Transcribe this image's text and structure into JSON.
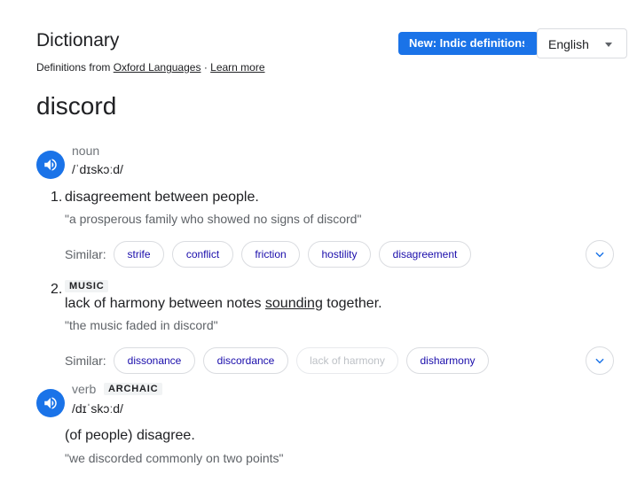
{
  "header": {
    "title": "Dictionary",
    "source_prefix": "Definitions from",
    "source_name": "Oxford Languages",
    "separator": "·",
    "learn_more": "Learn more",
    "promo": "New: Indic definitions",
    "language": "English"
  },
  "word": "discord",
  "entries": [
    {
      "pos": "noun",
      "pron": "/ˈdɪskɔːd/",
      "senses": [
        {
          "number": "1.",
          "definition": "disagreement between people.",
          "example": "\"a prosperous family who showed no signs of discord\"",
          "similar_label": "Similar:",
          "similar": [
            "strife",
            "conflict",
            "friction",
            "hostility",
            "disagreement"
          ]
        },
        {
          "number": "2.",
          "tag": "MUSIC",
          "definition_before": "lack of harmony between notes ",
          "definition_link": "sounding",
          "definition_after": " together.",
          "example": "\"the music faded in discord\"",
          "similar_label": "Similar:",
          "similar": [
            "dissonance",
            "discordance",
            "lack of harmony",
            "disharmony"
          ]
        }
      ]
    },
    {
      "pos": "verb",
      "tag": "ARCHAIC",
      "pron": "/dɪˈskɔːd/",
      "senses": [
        {
          "definition": "(of people) disagree.",
          "example": "\"we discorded commonly on two points\""
        }
      ]
    }
  ],
  "colors": {
    "accent": "#1a73e8",
    "link": "#1a0dab",
    "muted": "#5f6368"
  },
  "icons": {
    "speaker": "volume-icon",
    "expand": "chevron-down-icon",
    "dropdown": "caret-down-icon"
  }
}
